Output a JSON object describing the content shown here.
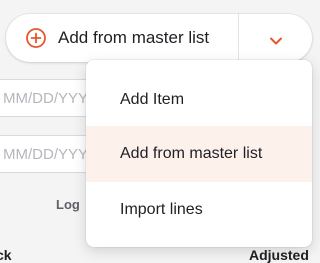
{
  "split_button": {
    "label": "Add from master list",
    "icon": "plus-circle-icon",
    "toggle_icon": "chevron-down-icon",
    "accent_color": "#e4572e"
  },
  "menu": {
    "items": [
      {
        "label": "Add Item"
      },
      {
        "label": "Add from master list",
        "highlighted": true
      },
      {
        "label": "Import lines"
      }
    ],
    "highlight_color": "#fdf1ec"
  },
  "background": {
    "date_field_1": {
      "placeholder": "MM/DD/YYYY"
    },
    "date_field_2": {
      "placeholder": "MM/DD/YYYY"
    },
    "tab_label": "Log",
    "column_left": "ck",
    "column_right": "Adjusted"
  }
}
